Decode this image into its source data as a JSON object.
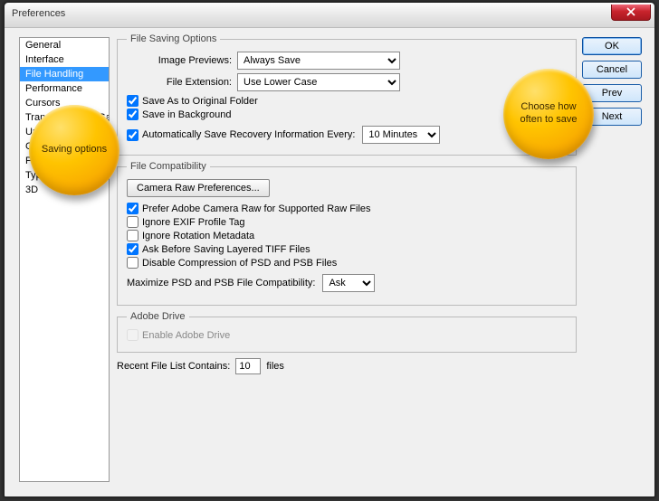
{
  "window": {
    "title": "Preferences"
  },
  "sidebar": {
    "items": [
      {
        "label": "General"
      },
      {
        "label": "Interface"
      },
      {
        "label": "File Handling",
        "selected": true
      },
      {
        "label": "Performance"
      },
      {
        "label": "Cursors"
      },
      {
        "label": "Transparency & Gamut"
      },
      {
        "label": "Units & Rulers"
      },
      {
        "label": "Guides, Grid & Slices"
      },
      {
        "label": "Plug-Ins"
      },
      {
        "label": "Type"
      },
      {
        "label": "3D"
      }
    ]
  },
  "buttons": {
    "ok": "OK",
    "cancel": "Cancel",
    "prev": "Prev",
    "next": "Next"
  },
  "fso": {
    "legend": "File Saving Options",
    "image_previews_label": "Image Previews:",
    "image_previews_value": "Always Save",
    "file_extension_label": "File Extension:",
    "file_extension_value": "Use Lower Case",
    "save_original": "Save As to Original Folder",
    "save_bg": "Save in Background",
    "autosave": "Automatically Save Recovery Information Every:",
    "autosave_value": "10 Minutes"
  },
  "fcomp": {
    "legend": "File Compatibility",
    "camera_raw_btn": "Camera Raw Preferences...",
    "prefer_acr": "Prefer Adobe Camera Raw for Supported Raw Files",
    "ignore_exif": "Ignore EXIF Profile Tag",
    "ignore_rot": "Ignore Rotation Metadata",
    "ask_tiff": "Ask Before Saving Layered TIFF Files",
    "disable_psd": "Disable Compression of PSD and PSB Files",
    "max_label": "Maximize PSD and PSB File Compatibility:",
    "max_value": "Ask"
  },
  "adrive": {
    "legend": "Adobe Drive",
    "enable": "Enable Adobe Drive"
  },
  "recent": {
    "label_pre": "Recent File List Contains:",
    "value": "10",
    "label_post": "files"
  },
  "callouts": {
    "left": "Saving options",
    "right": "Choose how often to save"
  }
}
